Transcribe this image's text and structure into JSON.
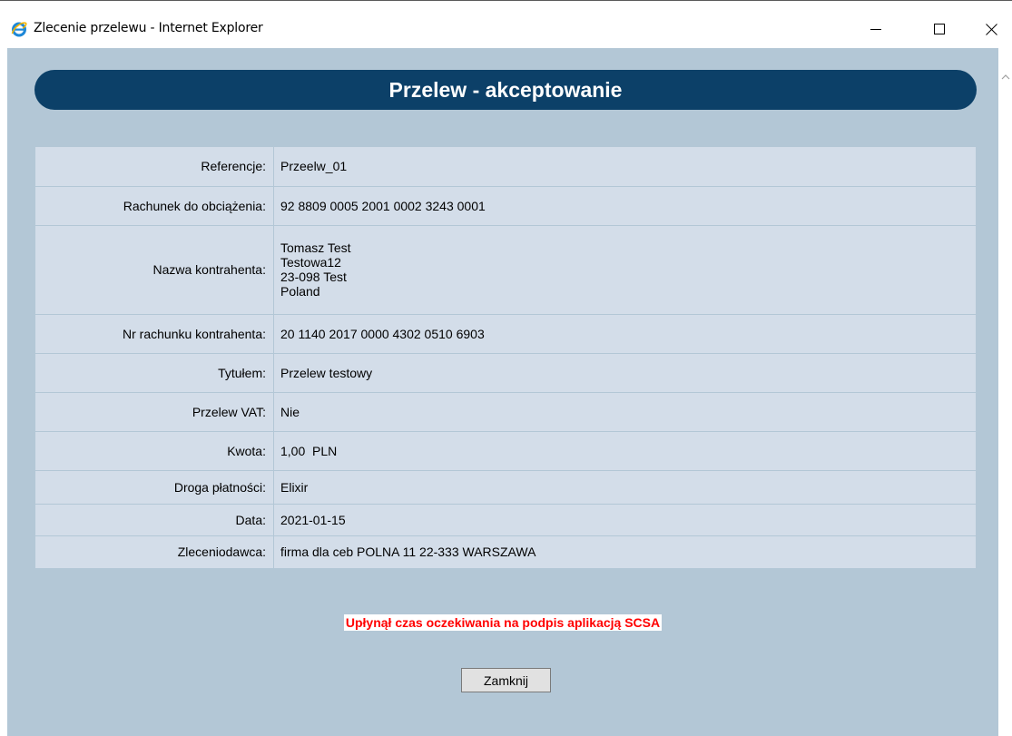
{
  "window": {
    "title": "Zlecenie przelewu - Internet Explorer",
    "icon": "internet-explorer-icon",
    "controls": [
      "minimize-icon",
      "maximize-icon",
      "close-icon"
    ]
  },
  "page": {
    "header_title": "Przelew - akceptowanie",
    "header_color": "#0c4068",
    "background_color": "#b3c7d6",
    "table_color": "#d3dde9"
  },
  "details": {
    "rows": [
      {
        "label": "Referencje:",
        "value": "Przeelw_01"
      },
      {
        "label": "Rachunek do obciążenia:",
        "value": "92 8809 0005 2001 0002 3243 0001"
      },
      {
        "label": "Nazwa kontrahenta:",
        "value_lines": [
          "Tomasz Test",
          "Testowa12",
          "23-098 Test",
          "Poland"
        ]
      },
      {
        "label": "Nr rachunku kontrahenta:",
        "value": "20 1140 2017 0000 4302 0510 6903"
      },
      {
        "label": "Tytułem:",
        "value": "Przelew testowy"
      },
      {
        "label": "Przelew VAT:",
        "value": "Nie"
      },
      {
        "label": "Kwota:",
        "value": "1,00  PLN"
      },
      {
        "label": "Droga płatności:",
        "value": "Elixir"
      },
      {
        "label": "Data:",
        "value": "2021-01-15"
      },
      {
        "label": "Zleceniodawca:",
        "value": "firma dla ceb POLNA 11 22-333 WARSZAWA"
      }
    ]
  },
  "status": {
    "error_message": "Upłynął czas oczekiwania na podpis aplikacją SCSA",
    "error_color": "#ff0000"
  },
  "actions": {
    "close_label": "Zamknij"
  }
}
